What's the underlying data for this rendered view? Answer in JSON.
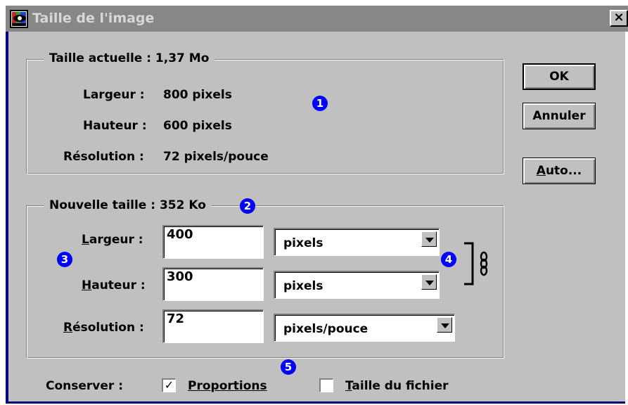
{
  "window": {
    "title": "Taille de l'image",
    "close_label": "×"
  },
  "current": {
    "legend": "Taille actuelle : 1,37 Mo",
    "width_label": "Largeur :",
    "width_value": "800 pixels",
    "height_label": "Hauteur :",
    "height_value": "600 pixels",
    "resolution_label": "Résolution :",
    "resolution_value": "72 pixels/pouce"
  },
  "new_size": {
    "legend": "Nouvelle taille : 352 Ko",
    "width_label_underline": "L",
    "width_label_rest": "argeur :",
    "width_value": "400",
    "width_unit": "pixels",
    "height_label_underline": "H",
    "height_label_rest": "auteur :",
    "height_value": "300",
    "height_unit": "pixels",
    "resolution_label_underline": "R",
    "resolution_label_rest": "ésolution :",
    "resolution_value": "72",
    "resolution_unit": "pixels/pouce"
  },
  "buttons": {
    "ok": "OK",
    "cancel": "Annuler",
    "auto_underline": "A",
    "auto_rest": "uto..."
  },
  "keep": {
    "label": "Conserver :",
    "proportions_underline": "P",
    "proportions_rest": "roportions",
    "proportions_checked": true,
    "proportions_mark": "✓",
    "filesize_underline": "T",
    "filesize_rest": "aille du fichier",
    "filesize_checked": false
  },
  "badges": [
    "1",
    "2",
    "3",
    "4",
    "5"
  ],
  "colors": {
    "badge": "#0000ff",
    "title_bar": "#878787",
    "dialog_bg": "#c0c0c0",
    "frame": "#00007b"
  }
}
